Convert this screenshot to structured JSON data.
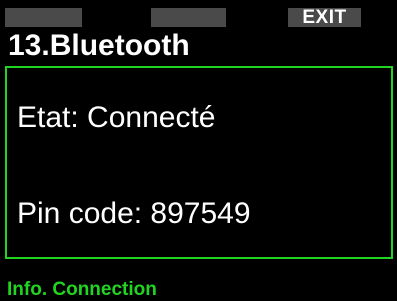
{
  "softkeys": {
    "left_label": "",
    "middle_label": "",
    "right_label": "EXIT"
  },
  "header": {
    "title": "13.Bluetooth"
  },
  "info_panel": {
    "status_text": "Etat: Connecté",
    "pin_text": "Pin code: 897549"
  },
  "footer": {
    "label": "Info. Connection"
  },
  "colors": {
    "background": "#000000",
    "accent": "#22d422",
    "softkey": "#4a4a4a",
    "text": "#ffffff"
  }
}
